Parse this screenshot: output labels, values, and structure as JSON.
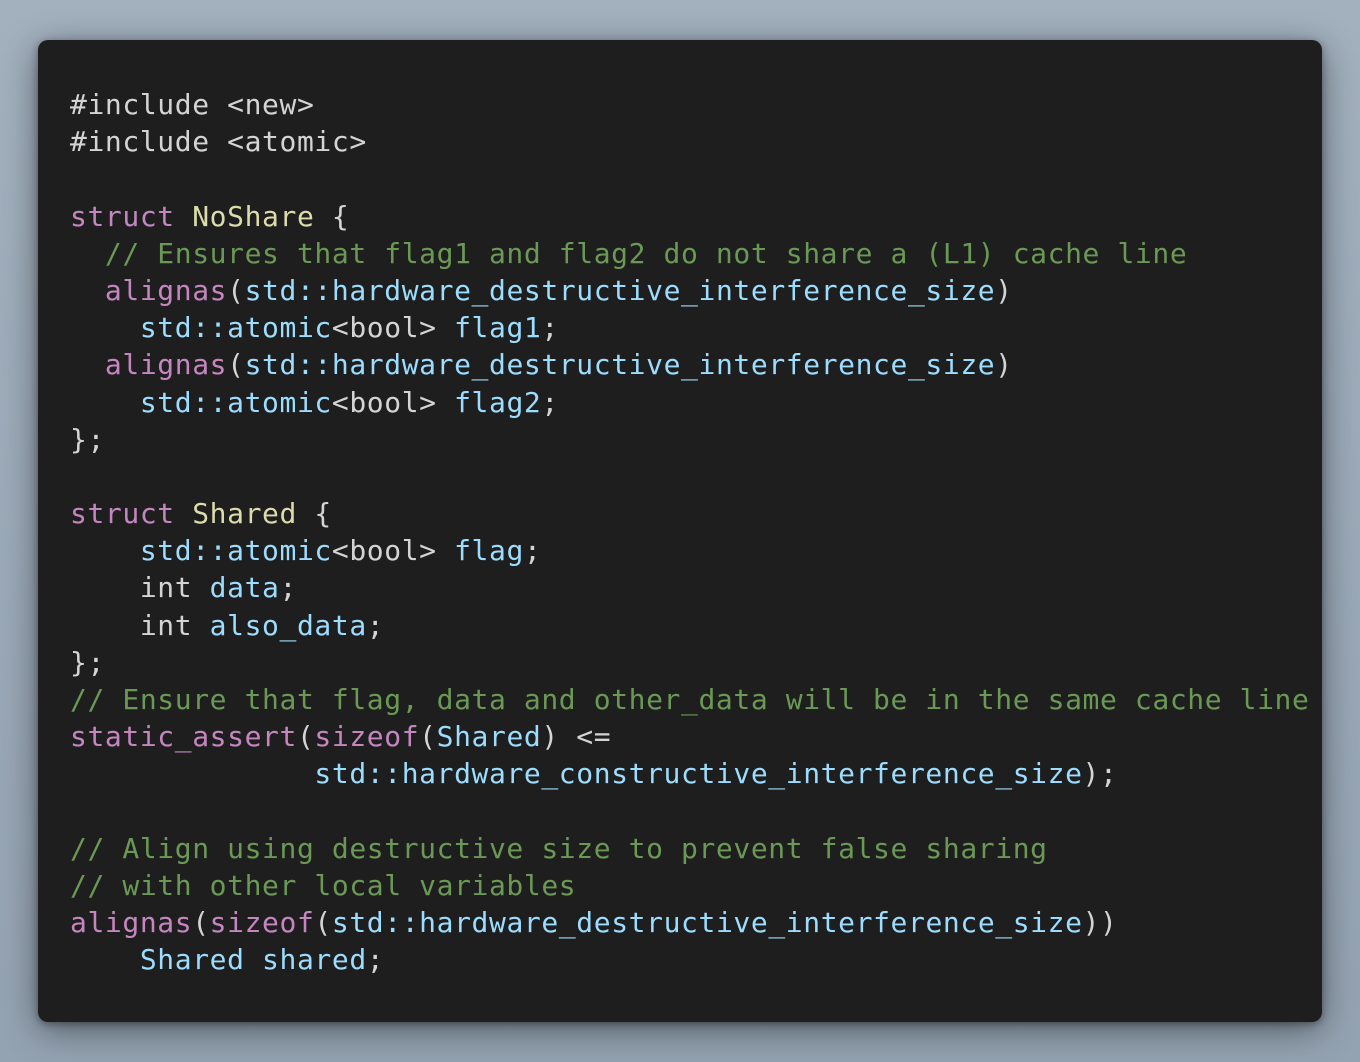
{
  "code": {
    "lines": [
      [
        {
          "t": "#include <new>",
          "c": "pl"
        }
      ],
      [
        {
          "t": "#include <atomic>",
          "c": "pl"
        }
      ],
      [],
      [
        {
          "t": "struct ",
          "c": "kw"
        },
        {
          "t": "NoShare",
          "c": "type"
        },
        {
          "t": " {",
          "c": "pl"
        }
      ],
      [
        {
          "t": "  // Ensures that flag1 and flag2 do not share a (L1) cache line",
          "c": "cm"
        }
      ],
      [
        {
          "t": "  ",
          "c": "pl"
        },
        {
          "t": "alignas",
          "c": "kw"
        },
        {
          "t": "(",
          "c": "pl"
        },
        {
          "t": "std::hardware_destructive_interference_size",
          "c": "id"
        },
        {
          "t": ")",
          "c": "pl"
        }
      ],
      [
        {
          "t": "    ",
          "c": "pl"
        },
        {
          "t": "std::atomic",
          "c": "id"
        },
        {
          "t": "<bool> ",
          "c": "pl"
        },
        {
          "t": "flag1",
          "c": "id"
        },
        {
          "t": ";",
          "c": "pl"
        }
      ],
      [
        {
          "t": "  ",
          "c": "pl"
        },
        {
          "t": "alignas",
          "c": "kw"
        },
        {
          "t": "(",
          "c": "pl"
        },
        {
          "t": "std::hardware_destructive_interference_size",
          "c": "id"
        },
        {
          "t": ")",
          "c": "pl"
        }
      ],
      [
        {
          "t": "    ",
          "c": "pl"
        },
        {
          "t": "std::atomic",
          "c": "id"
        },
        {
          "t": "<bool> ",
          "c": "pl"
        },
        {
          "t": "flag2",
          "c": "id"
        },
        {
          "t": ";",
          "c": "pl"
        }
      ],
      [
        {
          "t": "};",
          "c": "pl"
        }
      ],
      [],
      [
        {
          "t": "struct ",
          "c": "kw"
        },
        {
          "t": "Shared",
          "c": "type"
        },
        {
          "t": " {",
          "c": "pl"
        }
      ],
      [
        {
          "t": "    ",
          "c": "pl"
        },
        {
          "t": "std::atomic",
          "c": "id"
        },
        {
          "t": "<bool> ",
          "c": "pl"
        },
        {
          "t": "flag",
          "c": "id"
        },
        {
          "t": ";",
          "c": "pl"
        }
      ],
      [
        {
          "t": "    int ",
          "c": "pl"
        },
        {
          "t": "data",
          "c": "id"
        },
        {
          "t": ";",
          "c": "pl"
        }
      ],
      [
        {
          "t": "    int ",
          "c": "pl"
        },
        {
          "t": "also_data",
          "c": "id"
        },
        {
          "t": ";",
          "c": "pl"
        }
      ],
      [
        {
          "t": "};",
          "c": "pl"
        }
      ],
      [
        {
          "t": "// Ensure that flag, data and other_data will be in the same cache line",
          "c": "cm"
        }
      ],
      [
        {
          "t": "static_assert",
          "c": "kw"
        },
        {
          "t": "(",
          "c": "pl"
        },
        {
          "t": "sizeof",
          "c": "kw"
        },
        {
          "t": "(",
          "c": "pl"
        },
        {
          "t": "Shared",
          "c": "id"
        },
        {
          "t": ") <=",
          "c": "pl"
        }
      ],
      [
        {
          "t": "              ",
          "c": "pl"
        },
        {
          "t": "std::hardware_constructive_interference_size",
          "c": "id"
        },
        {
          "t": ");",
          "c": "pl"
        }
      ],
      [],
      [
        {
          "t": "// Align using destructive size to prevent false sharing",
          "c": "cm"
        }
      ],
      [
        {
          "t": "// with other local variables",
          "c": "cm"
        }
      ],
      [
        {
          "t": "alignas",
          "c": "kw"
        },
        {
          "t": "(",
          "c": "pl"
        },
        {
          "t": "sizeof",
          "c": "kw"
        },
        {
          "t": "(",
          "c": "pl"
        },
        {
          "t": "std::hardware_destructive_interference_size",
          "c": "id"
        },
        {
          "t": "))",
          "c": "pl"
        }
      ],
      [
        {
          "t": "    ",
          "c": "pl"
        },
        {
          "t": "Shared shared",
          "c": "id"
        },
        {
          "t": ";",
          "c": "pl"
        }
      ]
    ]
  }
}
